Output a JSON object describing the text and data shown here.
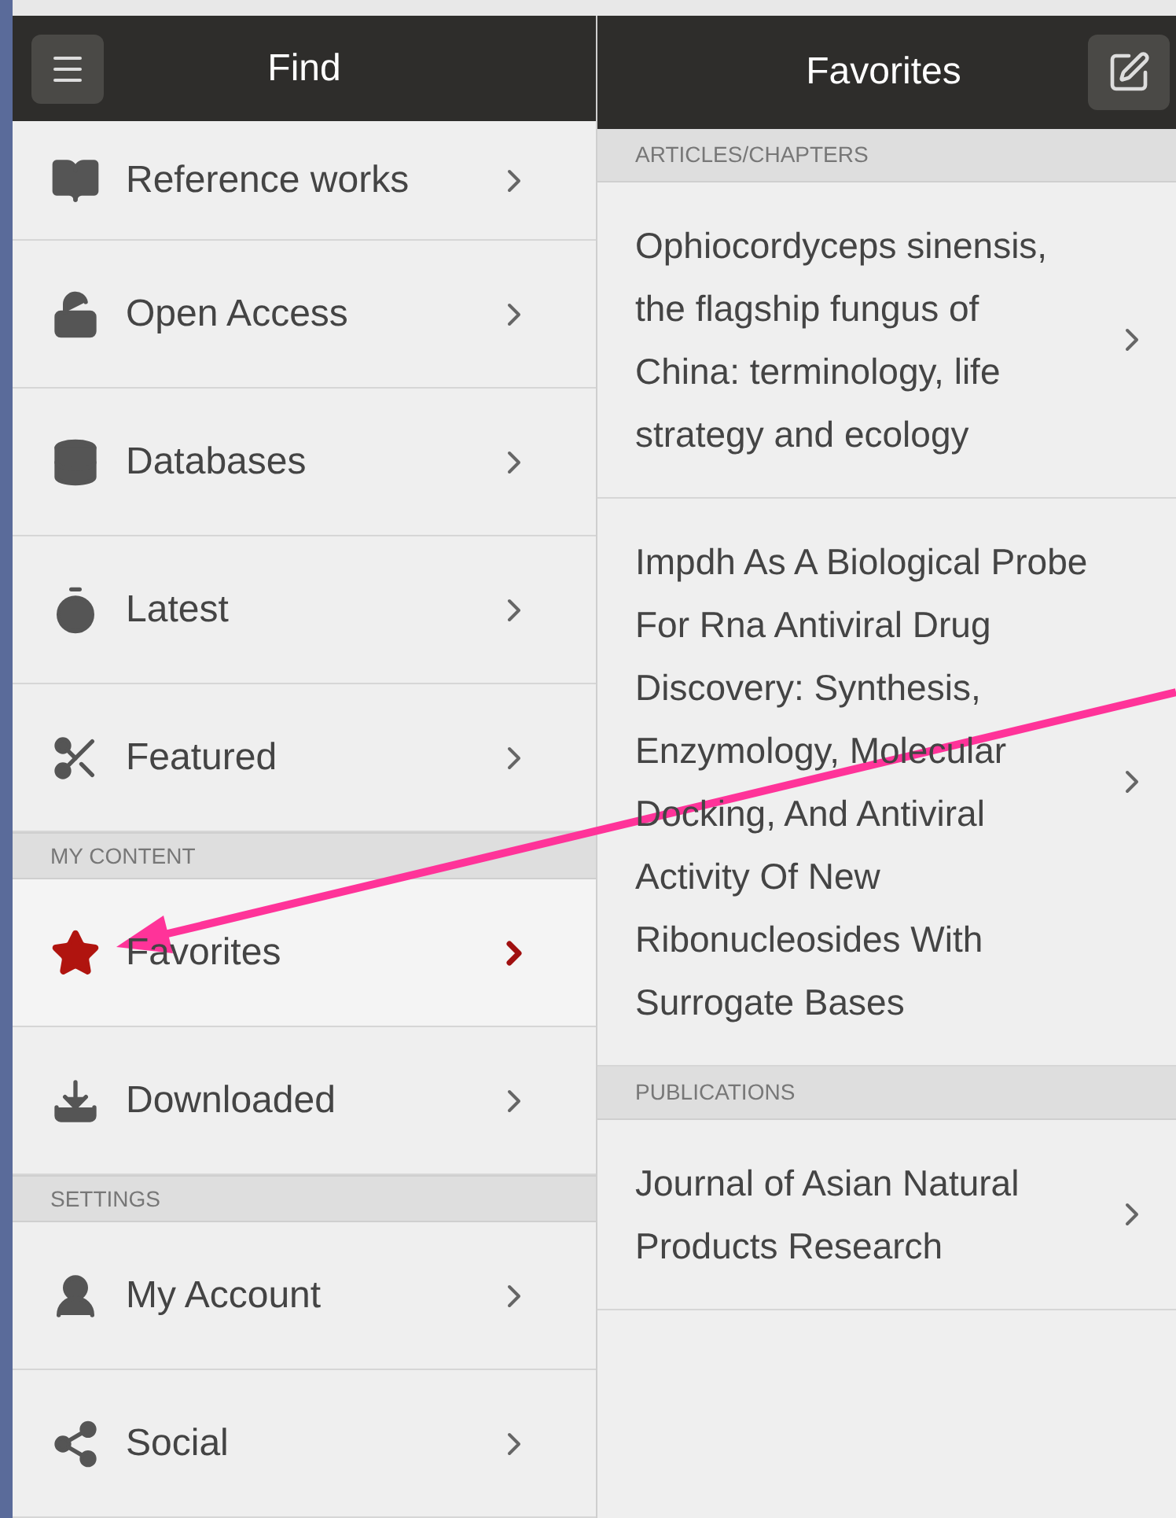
{
  "left_panel": {
    "title": "Find",
    "sections": [
      {
        "items": [
          {
            "label": "Reference works",
            "selected": false
          },
          {
            "label": "Open Access",
            "selected": false
          },
          {
            "label": "Databases",
            "selected": false
          },
          {
            "label": "Latest",
            "selected": false
          },
          {
            "label": "Featured",
            "selected": false
          }
        ]
      },
      {
        "heading": "MY CONTENT",
        "items": [
          {
            "label": "Favorites",
            "selected": true
          },
          {
            "label": "Downloaded",
            "selected": false
          }
        ]
      },
      {
        "heading": "SETTINGS",
        "items": [
          {
            "label": "My Account",
            "selected": false
          },
          {
            "label": "Social",
            "selected": false
          }
        ]
      }
    ]
  },
  "right_panel": {
    "title": "Favorites",
    "sections": [
      {
        "heading": "ARTICLES/CHAPTERS",
        "items": [
          "Ophiocordyceps sinensis, the flagship fungus of China: terminology, life strategy and ecology",
          "Impdh As A Biological Probe For Rna Antiviral Drug Discovery: Synthesis, Enzymology, Molecular Docking, And Antiviral Activity Of New Ribonucleosides With Surrogate Bases"
        ]
      },
      {
        "heading": "PUBLICATIONS",
        "items": [
          "Journal of Asian Natural Products Research"
        ]
      }
    ]
  }
}
